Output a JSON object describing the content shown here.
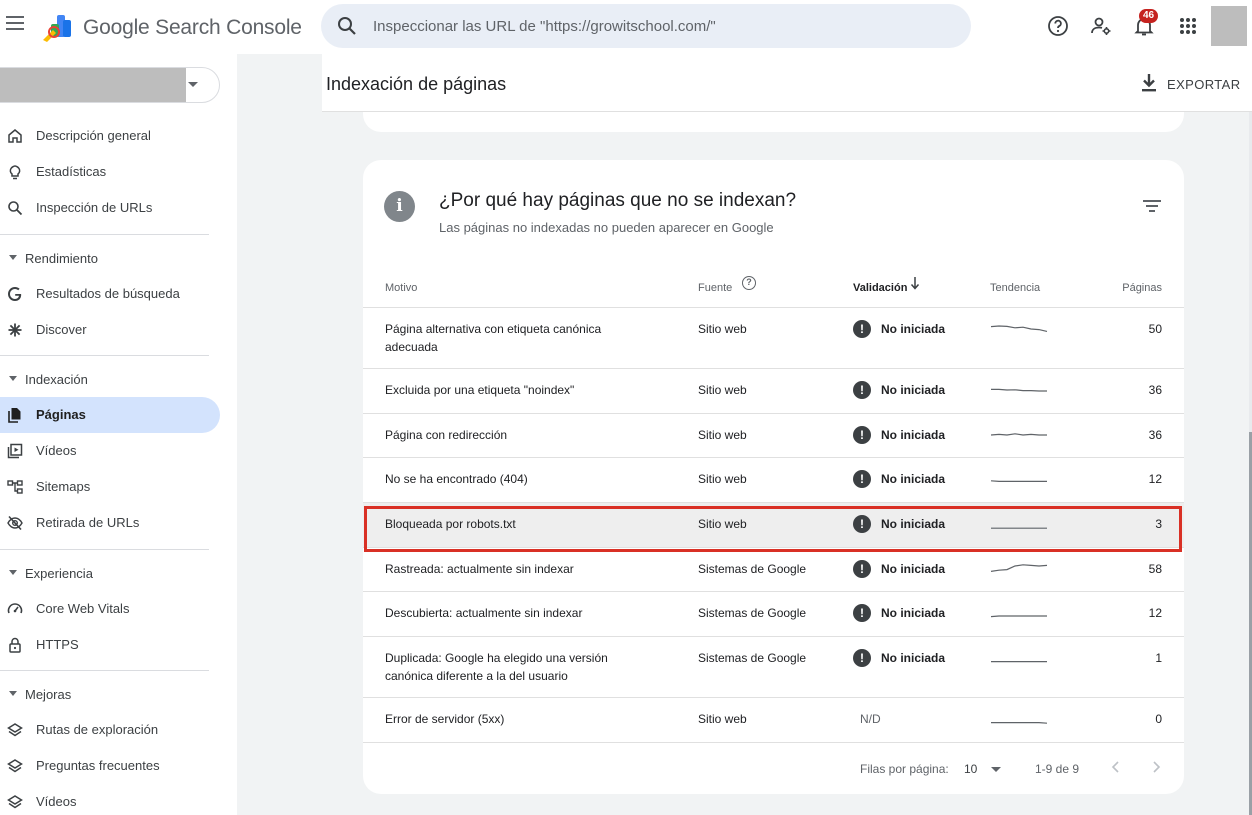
{
  "app": {
    "title": "Google Search Console",
    "search_placeholder": "Inspeccionar las URL de \"https://growitschool.com/\"",
    "notifications_count": "46"
  },
  "sidebar": {
    "items_top": [
      {
        "label": "Descripción general",
        "icon": "home-icon"
      },
      {
        "label": "Estadísticas",
        "icon": "lightbulb-icon"
      },
      {
        "label": "Inspección de URLs",
        "icon": "search-icon"
      }
    ],
    "sections": [
      {
        "label": "Rendimiento",
        "items": [
          {
            "label": "Resultados de búsqueda",
            "icon": "google-g-icon"
          },
          {
            "label": "Discover",
            "icon": "asterisk-icon"
          }
        ]
      },
      {
        "label": "Indexación",
        "items": [
          {
            "label": "Páginas",
            "icon": "pages-icon",
            "active": true
          },
          {
            "label": "Vídeos",
            "icon": "video-icon"
          },
          {
            "label": "Sitemaps",
            "icon": "sitemap-icon"
          },
          {
            "label": "Retirada de URLs",
            "icon": "eye-off-icon"
          }
        ]
      },
      {
        "label": "Experiencia",
        "items": [
          {
            "label": "Core Web Vitals",
            "icon": "gauge-icon"
          },
          {
            "label": "HTTPS",
            "icon": "lock-icon"
          }
        ]
      },
      {
        "label": "Mejoras",
        "items": [
          {
            "label": "Rutas de exploración",
            "icon": "layers-icon"
          },
          {
            "label": "Preguntas frecuentes",
            "icon": "layers-icon"
          },
          {
            "label": "Vídeos",
            "icon": "layers-icon"
          }
        ]
      }
    ]
  },
  "header": {
    "title": "Indexación de páginas",
    "export_label": "EXPORTAR"
  },
  "card": {
    "title": "¿Por qué hay páginas que no se indexan?",
    "subtitle": "Las páginas no indexadas no pueden aparecer en Google",
    "columns": {
      "motivo": "Motivo",
      "fuente": "Fuente",
      "validacion": "Validación",
      "tendencia": "Tendencia",
      "paginas": "Páginas"
    },
    "rows": [
      {
        "motivo": "Página alternativa con etiqueta canónica adecuada",
        "fuente": "Sitio web",
        "validacion": "No iniciada",
        "paginas": "50",
        "trend": [
          0.7,
          0.75,
          0.72,
          0.6,
          0.65,
          0.5,
          0.45,
          0.3
        ]
      },
      {
        "motivo": "Excluida por una etiqueta \"noindex\"",
        "fuente": "Sitio web",
        "validacion": "No iniciada",
        "paginas": "36",
        "trend": [
          0.55,
          0.55,
          0.5,
          0.52,
          0.45,
          0.45,
          0.42,
          0.42
        ]
      },
      {
        "motivo": "Página con redirección",
        "fuente": "Sitio web",
        "validacion": "No iniciada",
        "paginas": "36",
        "trend": [
          0.5,
          0.55,
          0.5,
          0.6,
          0.5,
          0.55,
          0.5,
          0.5
        ]
      },
      {
        "motivo": "No se ha encontrado (404)",
        "fuente": "Sitio web",
        "validacion": "No iniciada",
        "paginas": "12",
        "trend": [
          0.35,
          0.3,
          0.3,
          0.3,
          0.3,
          0.3,
          0.3,
          0.3
        ]
      },
      {
        "motivo": "Bloqueada por robots.txt",
        "fuente": "Sitio web",
        "validacion": "No iniciada",
        "paginas": "3",
        "trend": [
          0.15,
          0.15,
          0.15,
          0.15,
          0.15,
          0.15,
          0.15,
          0.15
        ],
        "highlighted": true
      },
      {
        "motivo": "Rastreada: actualmente sin indexar",
        "fuente": "Sistemas de Google",
        "validacion": "No iniciada",
        "paginas": "58",
        "trend": [
          0.3,
          0.4,
          0.45,
          0.75,
          0.85,
          0.8,
          0.75,
          0.8
        ]
      },
      {
        "motivo": "Descubierta: actualmente sin indexar",
        "fuente": "Sistemas de Google",
        "validacion": "No iniciada",
        "paginas": "12",
        "trend": [
          0.2,
          0.25,
          0.25,
          0.25,
          0.25,
          0.25,
          0.25,
          0.25
        ]
      },
      {
        "motivo": "Duplicada: Google ha elegido una versión canónica diferente a la del usuario",
        "fuente": "Sistemas de Google",
        "validacion": "No iniciada",
        "paginas": "1",
        "trend": [
          0.2,
          0.2,
          0.2,
          0.2,
          0.2,
          0.2,
          0.2,
          0.2
        ]
      },
      {
        "motivo": "Error de servidor (5xx)",
        "fuente": "Sitio web",
        "validacion": "N/D",
        "paginas": "0",
        "trend": [
          0.2,
          0.2,
          0.2,
          0.2,
          0.2,
          0.2,
          0.2,
          0.15
        ]
      }
    ],
    "pager": {
      "rows_label": "Filas por página:",
      "rows_value": "10",
      "range": "1-9 de 9"
    }
  },
  "colors": {
    "active_nav": "#d3e3fd",
    "highlight_border": "#d93025",
    "notification_badge": "#c5221f"
  }
}
